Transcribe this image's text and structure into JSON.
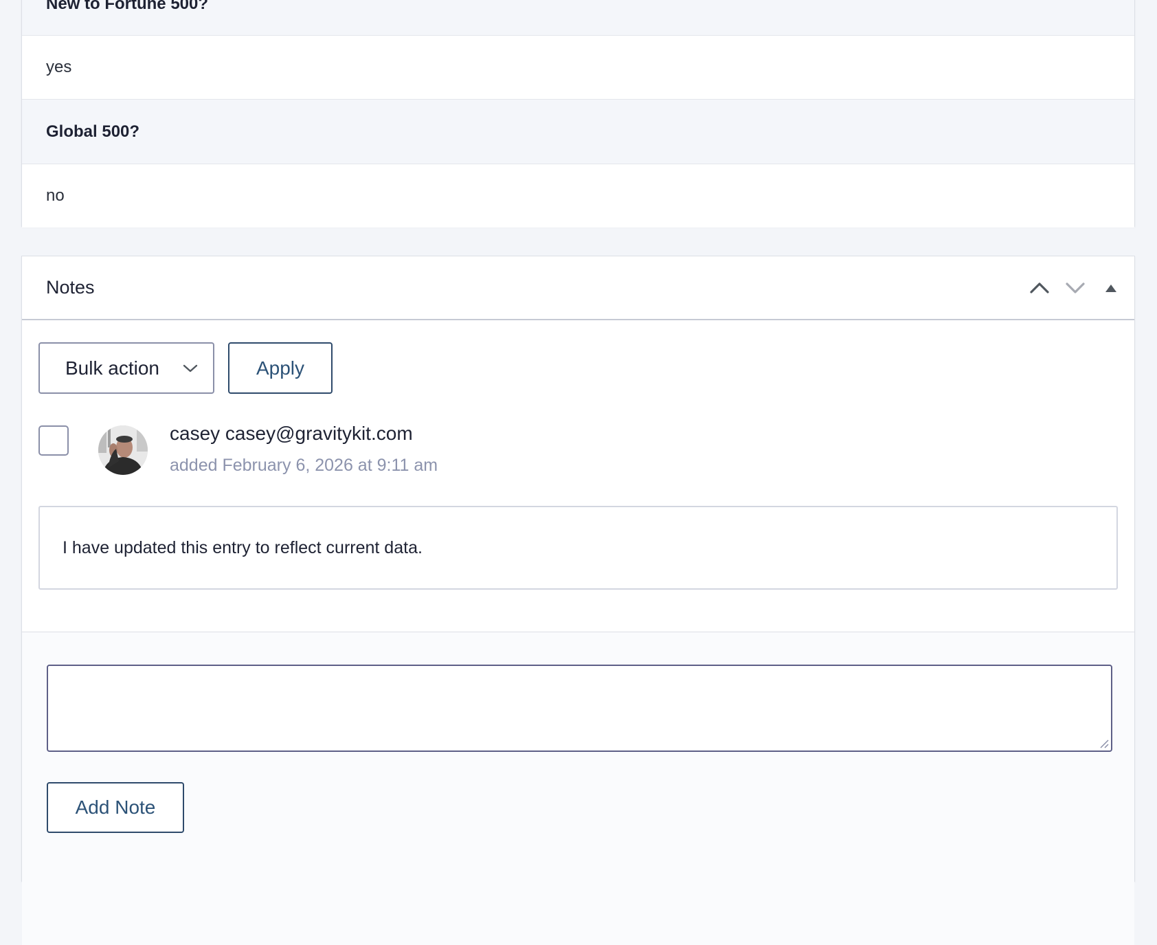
{
  "fields": [
    {
      "label": "New to Fortune 500?",
      "value": "yes"
    },
    {
      "label": "Global 500?",
      "value": "no"
    }
  ],
  "notes": {
    "title": "Notes",
    "bulk_action": {
      "selected": "Bulk action"
    },
    "apply_label": "Apply",
    "items": [
      {
        "author": "casey casey@gravitykit.com",
        "date": "added February 6, 2026 at 9:11 am",
        "text": "I have updated this entry to reflect current data."
      }
    ],
    "new_note_placeholder": "",
    "add_note_label": "Add Note"
  },
  "colors": {
    "accent": "#2c5277",
    "muted_text": "#8c93ad",
    "panel_bg": "#ffffff",
    "page_bg": "#f3f5f9"
  }
}
